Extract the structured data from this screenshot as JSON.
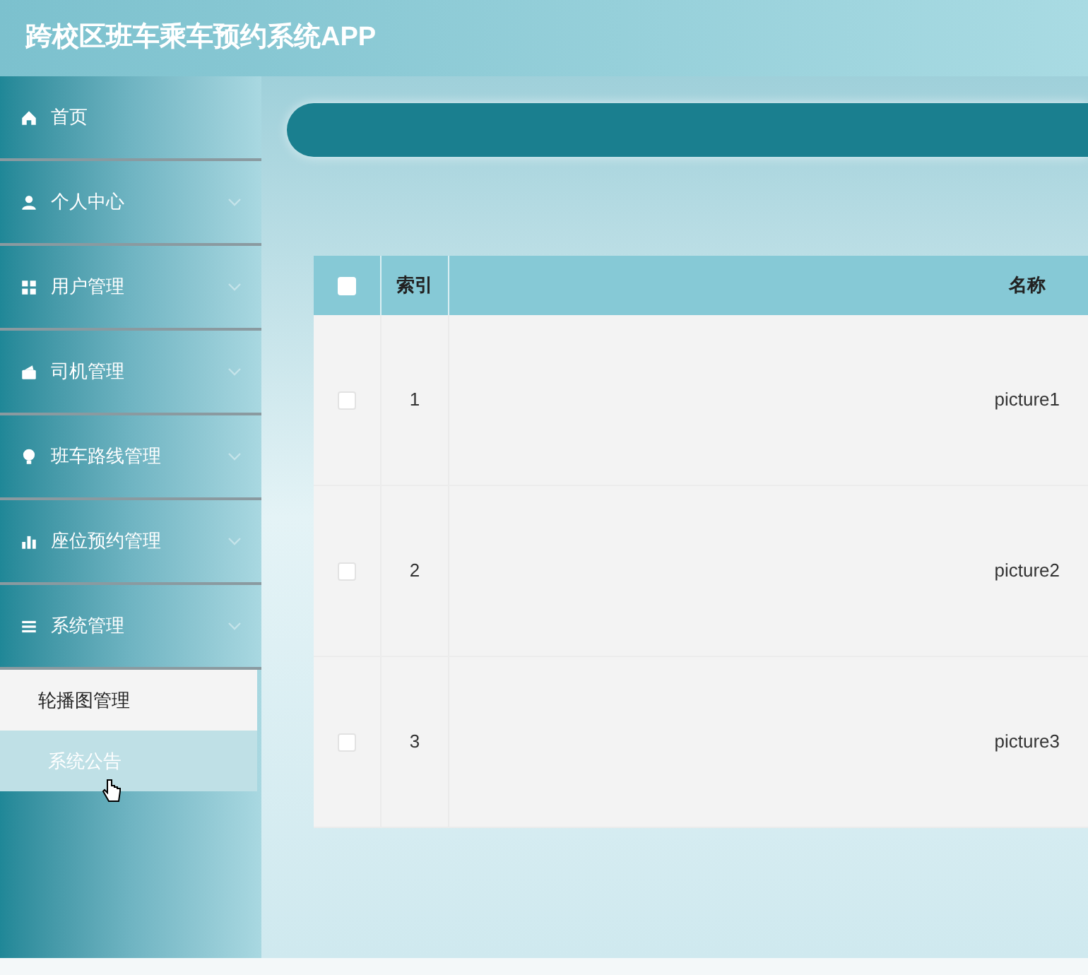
{
  "header": {
    "title": "跨校区班车乘车预约系统APP"
  },
  "sidebar": {
    "items": [
      {
        "label": "首页",
        "kind": "link"
      },
      {
        "label": "个人中心",
        "kind": "submenu"
      },
      {
        "label": "用户管理",
        "kind": "submenu"
      },
      {
        "label": "司机管理",
        "kind": "submenu"
      },
      {
        "label": "班车路线管理",
        "kind": "submenu"
      },
      {
        "label": "座位预约管理",
        "kind": "submenu"
      },
      {
        "label": "系统管理",
        "kind": "submenu",
        "children": [
          {
            "label": "轮播图管理",
            "hovered": false
          },
          {
            "label": "系统公告",
            "hovered": true
          }
        ]
      }
    ]
  },
  "table": {
    "columns": [
      "索引",
      "名称"
    ],
    "header_checked": false,
    "rows": [
      {
        "index": "1",
        "name": "picture1",
        "checked": false
      },
      {
        "index": "2",
        "name": "picture2",
        "checked": false
      },
      {
        "index": "3",
        "name": "picture3",
        "checked": false
      }
    ]
  }
}
